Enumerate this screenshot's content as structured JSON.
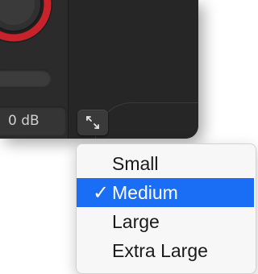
{
  "panel": {
    "value_readout": "0 dB",
    "accent_color": "#c8232a"
  },
  "resize_button": {
    "icon": "expand-arrows-icon"
  },
  "size_menu": {
    "check_glyph": "✓",
    "highlight_color": "#1a6ef5",
    "items": [
      {
        "label": "Small",
        "selected": false
      },
      {
        "label": "Medium",
        "selected": true
      },
      {
        "label": "Large",
        "selected": false
      },
      {
        "label": "Extra Large",
        "selected": false
      }
    ]
  }
}
